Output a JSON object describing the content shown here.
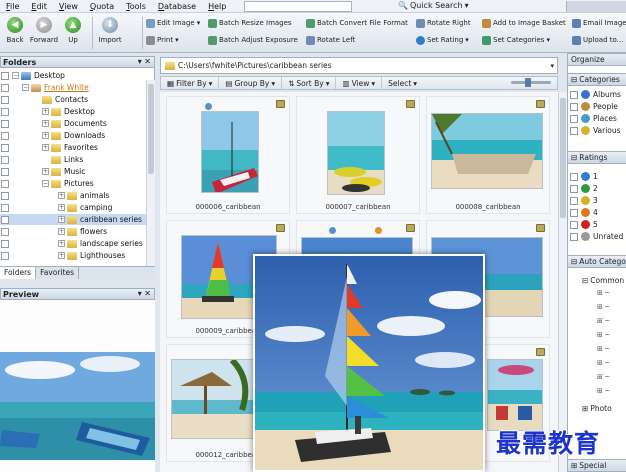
{
  "menu": [
    "File",
    "Edit",
    "View",
    "Quota",
    "Tools",
    "Database",
    "Help"
  ],
  "quick_search": {
    "label": "Quick Search"
  },
  "toolbar": {
    "back": "Back",
    "forward": "Forward",
    "up": "Up",
    "import": "Import",
    "edit_image": "Edit Image",
    "print": "Print",
    "batch_resize": "Batch Resize Images",
    "batch_adjust": "Batch Adjust Exposure",
    "batch_convert": "Batch Convert File Format",
    "rotate_left": "Rotate Left",
    "rotate_right": "Rotate Right",
    "set_rating": "Set Rating",
    "add_basket": "Add to Image Basket",
    "set_categories": "Set Categories",
    "email_images": "Email Image",
    "upload": "Upload to..."
  },
  "folders_panel": {
    "title": "Folders",
    "items": [
      {
        "label": "Desktop"
      },
      {
        "label": "Frank White"
      },
      {
        "label": "Contacts"
      },
      {
        "label": "Desktop"
      },
      {
        "label": "Documents"
      },
      {
        "label": "Downloads"
      },
      {
        "label": "Favorites"
      },
      {
        "label": "Links"
      },
      {
        "label": "Music"
      },
      {
        "label": "Pictures"
      },
      {
        "label": "animals"
      },
      {
        "label": "camping"
      },
      {
        "label": "caribbean series"
      },
      {
        "label": "flowers"
      },
      {
        "label": "landscape series"
      },
      {
        "label": "Lighthouses"
      }
    ],
    "tabs": [
      "Folders",
      "Favorites"
    ]
  },
  "preview_panel": {
    "title": "Preview"
  },
  "path": "C:\\Users\\fwhite\\Pictures\\caribbean series",
  "filter_bar": {
    "filter": "Filter By",
    "group": "Group By",
    "sort": "Sort By",
    "view": "View",
    "select": "Select"
  },
  "thumbnails": [
    {
      "caption": "000006_caribbean"
    },
    {
      "caption": "000007_caribbean"
    },
    {
      "caption": "000008_caribbean"
    },
    {
      "caption": "000009_caribbean"
    },
    {
      "caption": "000012_caribbean"
    }
  ],
  "organizer": {
    "title": "Organize",
    "categories_title": "Categories",
    "categories": [
      "Albums",
      "People",
      "Places",
      "Various"
    ],
    "ratings_title": "Ratings",
    "ratings": [
      {
        "label": "1",
        "color": "#2f7fd0"
      },
      {
        "label": "2",
        "color": "#2a9a3a"
      },
      {
        "label": "3",
        "color": "#d8b020"
      },
      {
        "label": "4",
        "color": "#e07820"
      },
      {
        "label": "5",
        "color": "#d02020"
      },
      {
        "label": "Unrated",
        "color": "#9a9a9a"
      }
    ],
    "auto_title": "Auto Categories",
    "auto_root": "Common",
    "photo_label": "Photo",
    "special_title": "Special"
  },
  "watermark": "最需教育"
}
